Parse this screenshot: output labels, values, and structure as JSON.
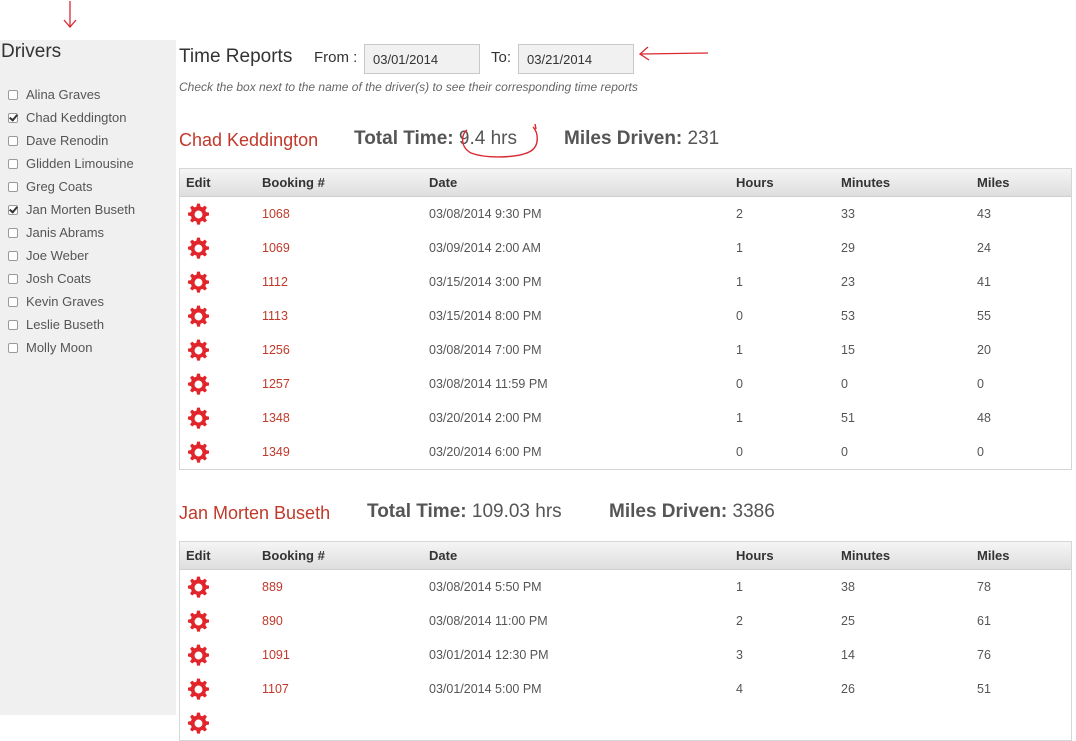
{
  "sidebar": {
    "title": "Drivers",
    "drivers": [
      {
        "name": "Alina Graves",
        "checked": false
      },
      {
        "name": "Chad Keddington",
        "checked": true
      },
      {
        "name": "Dave Renodin",
        "checked": false
      },
      {
        "name": "Glidden Limousine",
        "checked": false
      },
      {
        "name": "Greg Coats",
        "checked": false
      },
      {
        "name": "Jan Morten Buseth",
        "checked": true
      },
      {
        "name": "Janis Abrams",
        "checked": false
      },
      {
        "name": "Joe Weber",
        "checked": false
      },
      {
        "name": "Josh Coats",
        "checked": false
      },
      {
        "name": "Kevin Graves",
        "checked": false
      },
      {
        "name": "Leslie Buseth",
        "checked": false
      },
      {
        "name": "Molly Moon",
        "checked": false
      }
    ]
  },
  "header": {
    "title": "Time Reports",
    "from_label": "From :",
    "from_value": "03/01/2014",
    "to_label": "To:",
    "to_value": "03/21/2014",
    "hint": "Check the box next to the name of the driver(s) to see their corresponding time reports"
  },
  "columns": {
    "edit": "Edit",
    "booking": "Booking #",
    "date": "Date",
    "hours": "Hours",
    "minutes": "Minutes",
    "miles": "Miles"
  },
  "reports": [
    {
      "driver": "Chad Keddington",
      "total_time_label": "Total Time:",
      "total_time": "9.4 hrs",
      "miles_label": "Miles Driven:",
      "miles": "231",
      "rows": [
        {
          "booking": "1068",
          "date": "03/08/2014 9:30 PM",
          "hours": "2",
          "minutes": "33",
          "miles": "43"
        },
        {
          "booking": "1069",
          "date": "03/09/2014 2:00 AM",
          "hours": "1",
          "minutes": "29",
          "miles": "24"
        },
        {
          "booking": "1112",
          "date": "03/15/2014 3:00 PM",
          "hours": "1",
          "minutes": "23",
          "miles": "41"
        },
        {
          "booking": "1113",
          "date": "03/15/2014 8:00 PM",
          "hours": "0",
          "minutes": "53",
          "miles": "55"
        },
        {
          "booking": "1256",
          "date": "03/08/2014 7:00 PM",
          "hours": "1",
          "minutes": "15",
          "miles": "20"
        },
        {
          "booking": "1257",
          "date": "03/08/2014 11:59 PM",
          "hours": "0",
          "minutes": "0",
          "miles": "0"
        },
        {
          "booking": "1348",
          "date": "03/20/2014 2:00 PM",
          "hours": "1",
          "minutes": "51",
          "miles": "48"
        },
        {
          "booking": "1349",
          "date": "03/20/2014 6:00 PM",
          "hours": "0",
          "minutes": "0",
          "miles": "0"
        }
      ]
    },
    {
      "driver": "Jan Morten Buseth",
      "total_time_label": "Total Time:",
      "total_time": "109.03 hrs",
      "miles_label": "Miles Driven:",
      "miles": "3386",
      "rows": [
        {
          "booking": "889",
          "date": "03/08/2014 5:50 PM",
          "hours": "1",
          "minutes": "38",
          "miles": "78"
        },
        {
          "booking": "890",
          "date": "03/08/2014 11:00 PM",
          "hours": "2",
          "minutes": "25",
          "miles": "61"
        },
        {
          "booking": "1091",
          "date": "03/01/2014 12:30 PM",
          "hours": "3",
          "minutes": "14",
          "miles": "76"
        },
        {
          "booking": "1107",
          "date": "03/01/2014 5:00 PM",
          "hours": "4",
          "minutes": "26",
          "miles": "51"
        }
      ]
    }
  ],
  "icons": {
    "edit": "gear-icon"
  },
  "colors": {
    "accent": "#c0392b",
    "sidebar_bg": "#f0f0f0",
    "annotation": "#d9282f"
  }
}
